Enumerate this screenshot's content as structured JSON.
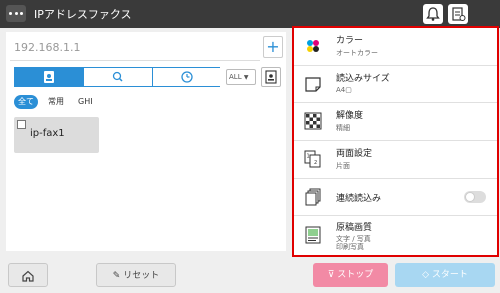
{
  "app": {
    "title": "IPアドレスファクス"
  },
  "address": {
    "value": "192.168.1.1",
    "add_label": "+"
  },
  "filters": [
    {
      "label": "全て",
      "active": true
    },
    {
      "label": "常用",
      "active": false
    },
    {
      "label": "GHI",
      "active": false
    }
  ],
  "all_dropdown": {
    "label": "ALL"
  },
  "entries": [
    {
      "name": "ip-fax1"
    }
  ],
  "settings": [
    {
      "label": "カラー",
      "value": "オートカラー",
      "icon": "color-dots-icon"
    },
    {
      "label": "読込みサイズ",
      "value": "A4▢",
      "icon": "paper-size-icon"
    },
    {
      "label": "解像度",
      "value": "精細",
      "icon": "checker-resolution-icon"
    },
    {
      "label": "両面設定",
      "value": "片面",
      "icon": "duplex-pages-icon"
    },
    {
      "label": "連続読込み",
      "icon": "stacked-pages-icon",
      "toggle": false
    },
    {
      "label": "原稿画質",
      "value": "文字 / 写真",
      "value2": "印刷写真",
      "icon": "document-photo-icon"
    }
  ],
  "bottom": {
    "reset_label": "リセット",
    "stop_label": "ストップ",
    "start_label": "スタート"
  },
  "colors": {
    "accent": "#2b8fd6",
    "highlight": "#e00000",
    "stop": "#f28aa5",
    "start": "#a8d7f2"
  }
}
